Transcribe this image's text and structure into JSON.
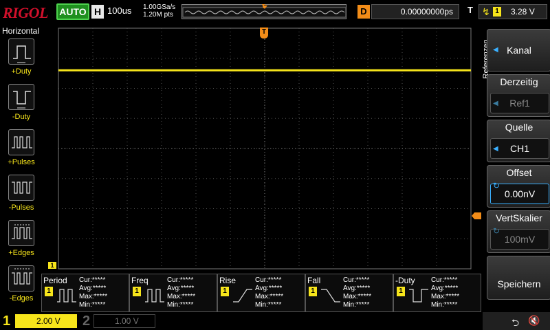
{
  "brand": "RIGOL",
  "top": {
    "auto_label": "AUTO",
    "h_tag": "H",
    "timebase": "100us",
    "sample_rate": "1.00GSa/s",
    "memory_depth": "1.20M pts",
    "mem_trigger_tag": "T",
    "d_tag": "D",
    "delay_value": "0.00000000ps",
    "t_tag": "T",
    "trigger_channel": "1",
    "trigger_level": "3.28 V"
  },
  "left_panel": {
    "title": "Horizontal",
    "items": [
      {
        "label": "+Duty",
        "icon": "positive-duty-icon"
      },
      {
        "label": "-Duty",
        "icon": "negative-duty-icon"
      },
      {
        "label": "+Pulses",
        "icon": "positive-pulses-icon"
      },
      {
        "label": "-Pulses",
        "icon": "negative-pulses-icon"
      },
      {
        "label": "+Edges",
        "icon": "positive-edges-icon"
      },
      {
        "label": "-Edges",
        "icon": "negative-edges-icon"
      }
    ]
  },
  "grid": {
    "trigger_marker": "T",
    "ch1_marker": "1",
    "trace_color": "#f7e51b"
  },
  "right_menu": {
    "tab_label": "Referenzen",
    "items": [
      {
        "title": "Kanal"
      },
      {
        "title": "Derzeitig",
        "value": "Ref1"
      },
      {
        "title": "Quelle",
        "value": "CH1"
      },
      {
        "title": "Offset",
        "value": "0.00nV"
      },
      {
        "title": "VertSkalier",
        "value": "100mV"
      },
      {
        "title": "Speichern"
      }
    ]
  },
  "readouts": [
    {
      "name": "Period",
      "channel": "1",
      "cur": "Cur:*****",
      "avg": "Avg:*****",
      "max": "Max:*****",
      "min": "Min:*****"
    },
    {
      "name": "Freq",
      "channel": "1",
      "cur": "Cur:*****",
      "avg": "Avg:*****",
      "max": "Max:*****",
      "min": "Min:*****"
    },
    {
      "name": "Rise",
      "channel": "1",
      "cur": "Cur:*****",
      "avg": "Avg:*****",
      "max": "Max:*****",
      "min": "Min:*****"
    },
    {
      "name": "Fall",
      "channel": "1",
      "cur": "Cur:*****",
      "avg": "Avg:*****",
      "max": "Max:*****",
      "min": "Min:*****"
    },
    {
      "name": "-Duty",
      "channel": "1",
      "cur": "Cur:*****",
      "avg": "Avg:*****",
      "max": "Max:*****",
      "min": "Min:*****"
    }
  ],
  "bottom": {
    "ch1_num": "1",
    "ch1_scale": "2.00 V",
    "ch2_num": "2",
    "ch2_scale": "1.00 V"
  },
  "colors": {
    "brand_red": "#d0102b",
    "ch1_yellow": "#f7e51b",
    "trigger_orange": "#f28c18",
    "auto_green": "#1f8f1f",
    "menu_blue": "#3ab0ff"
  }
}
